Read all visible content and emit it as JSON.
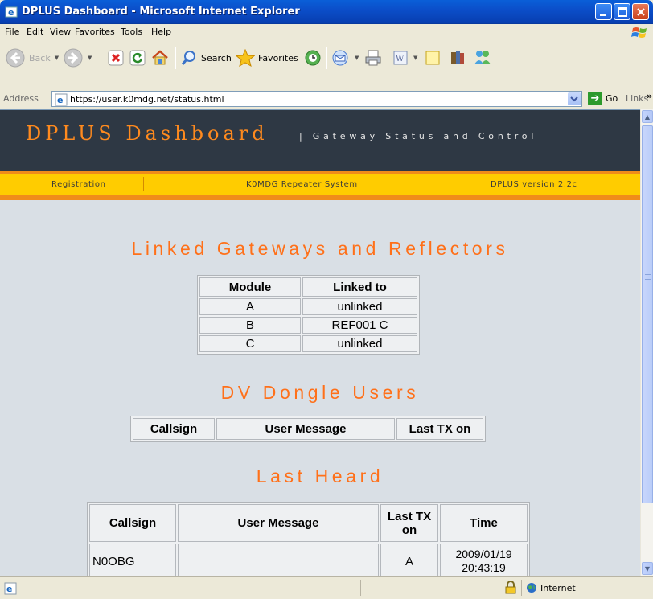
{
  "window": {
    "title": "DPLUS Dashboard - Microsoft Internet Explorer"
  },
  "menu": [
    "File",
    "Edit",
    "View",
    "Favorites",
    "Tools",
    "Help"
  ],
  "toolbar": {
    "back": "Back",
    "search": "Search",
    "favorites": "Favorites"
  },
  "address": {
    "label": "Address",
    "url": "https://user.k0mdg.net/status.html",
    "go": "Go",
    "links": "Links"
  },
  "page": {
    "banner_title": "DPLUS Dashboard",
    "banner_subtitle": "| Gateway Status and Control",
    "nav_registration": "Registration",
    "nav_system": "K0MDG Repeater System",
    "nav_version": "DPLUS version 2.2c",
    "linked": {
      "heading": "Linked Gateways and Reflectors",
      "headers": [
        "Module",
        "Linked to"
      ],
      "rows": [
        [
          "A",
          "unlinked"
        ],
        [
          "B",
          "REF001 C"
        ],
        [
          "C",
          "unlinked"
        ]
      ]
    },
    "dongle": {
      "heading": "DV Dongle Users",
      "headers": [
        "Callsign",
        "User Message",
        "Last TX on"
      ]
    },
    "lastheard": {
      "heading": "Last Heard",
      "headers": [
        "Callsign",
        "User Message",
        "Last TX on",
        "Time"
      ],
      "rows": [
        {
          "callsign": "N0OBG",
          "message": "",
          "last_tx": "A",
          "date": "2009/01/19",
          "time": "20:43:19"
        }
      ]
    }
  },
  "status": {
    "zone": "Internet"
  },
  "colors": {
    "accent_orange": "#ff7019",
    "banner": "#2e3844",
    "nav_yellow": "#ffcc00"
  }
}
